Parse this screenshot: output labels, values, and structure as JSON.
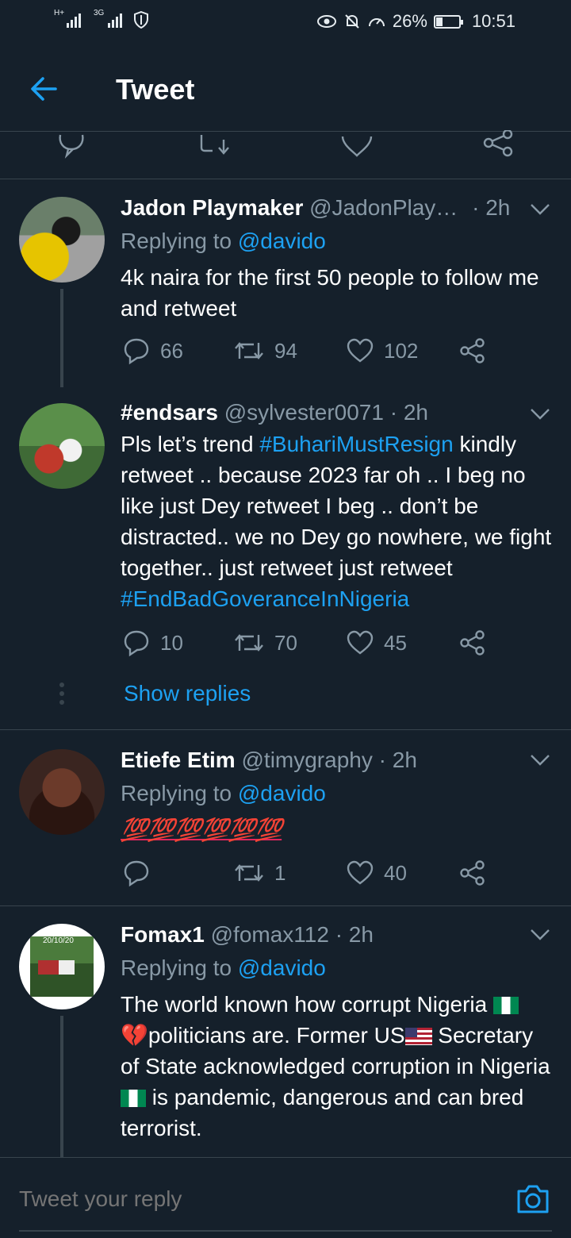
{
  "status_bar": {
    "signal1_tag": "H+",
    "signal2_tag": "3G",
    "battery_percent": "26%",
    "time": "10:51"
  },
  "header": {
    "title": "Tweet"
  },
  "tweets": [
    {
      "name": "Jadon Playmaker",
      "handle": "@JadonPlay…",
      "time": "· 2h",
      "replying_prefix": "Replying to ",
      "replying_to": "@davido",
      "body": "4k naira for the first 50 people to follow me and retweet",
      "replies": "66",
      "retweets": "94",
      "likes": "102"
    },
    {
      "name": "#endsars",
      "handle": "@sylvester0071",
      "time": "· 2h",
      "body_parts": {
        "p1": "Pls let’s trend ",
        "tag1": "#BuhariMustResign",
        "p2": "  kindly retweet .. because 2023 far oh .. I beg no like just Dey retweet I beg .. don’t be distracted.. we no Dey go nowhere, we fight together.. just retweet just retweet ",
        "tag2": "#EndBadGoveranceInNigeria"
      },
      "replies": "10",
      "retweets": "70",
      "likes": "45",
      "show_replies": "Show replies"
    },
    {
      "name": "Etiefe Etim",
      "handle": "@timygraphy",
      "time": "· 2h",
      "replying_prefix": "Replying to ",
      "replying_to": "@davido",
      "body": "💯💯💯💯💯💯",
      "replies": "",
      "retweets": "1",
      "likes": "40"
    },
    {
      "name": "Fomax1",
      "handle": "@fomax112",
      "time": "· 2h",
      "replying_prefix": "Replying to ",
      "replying_to": "@davido",
      "body_parts": {
        "p1": "The world known how corrupt Nigeria ",
        "p2": "politicians are. Former US",
        "p3": " Secretary of State acknowledged corruption in Nigeria",
        "p4": " is pandemic, dangerous and can bred terrorist."
      },
      "avatar_text": "20/10/20"
    }
  ],
  "reply_bar": {
    "placeholder": "Tweet your reply"
  },
  "colors": {
    "background": "#15202b",
    "accent": "#1da1f2",
    "muted": "#8899a6",
    "divider": "#38444d"
  },
  "icons": [
    "back-arrow-icon",
    "reply-icon",
    "retweet-icon",
    "like-icon",
    "share-icon",
    "caret-down-icon",
    "camera-icon"
  ]
}
